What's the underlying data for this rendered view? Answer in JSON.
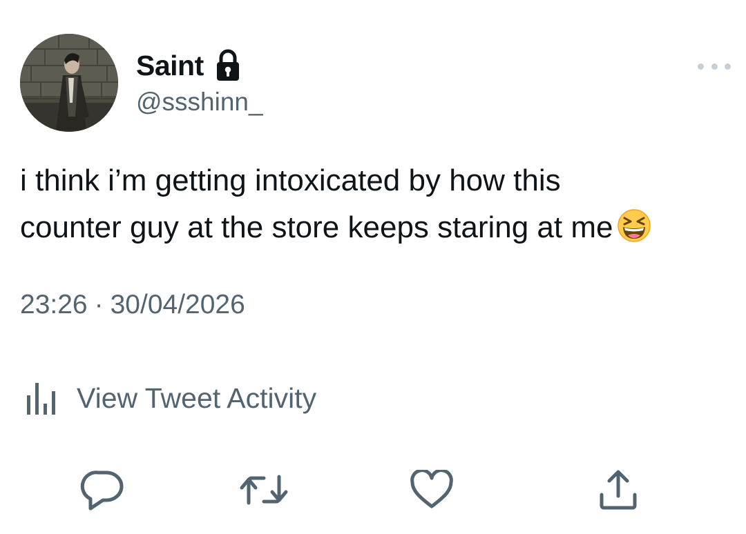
{
  "author": {
    "display_name": "Saint",
    "handle": "@ssshinn_",
    "protected_icon": "lock-icon",
    "avatar": "profile-photo"
  },
  "tweet": {
    "lines": [
      "i think i’m getting intoxicated by how this",
      "counter guy at the store keeps staring at me"
    ],
    "emoji": "grinning-squinting-face-emoji",
    "time": "23:26",
    "separator": "·",
    "date": "30/04/2026"
  },
  "activity": {
    "label": "View Tweet Activity",
    "icon": "bar-chart-icon"
  },
  "actions": [
    {
      "name": "reply",
      "icon": "reply-icon"
    },
    {
      "name": "retweet",
      "icon": "retweet-icon"
    },
    {
      "name": "like",
      "icon": "heart-icon"
    },
    {
      "name": "share",
      "icon": "share-icon"
    }
  ],
  "colors": {
    "text_primary": "#0f1419",
    "text_secondary": "#536471",
    "icon_gray": "#536471",
    "more_dots": "#c4cfd6",
    "emoji_yellow": "#ffcc4d"
  }
}
